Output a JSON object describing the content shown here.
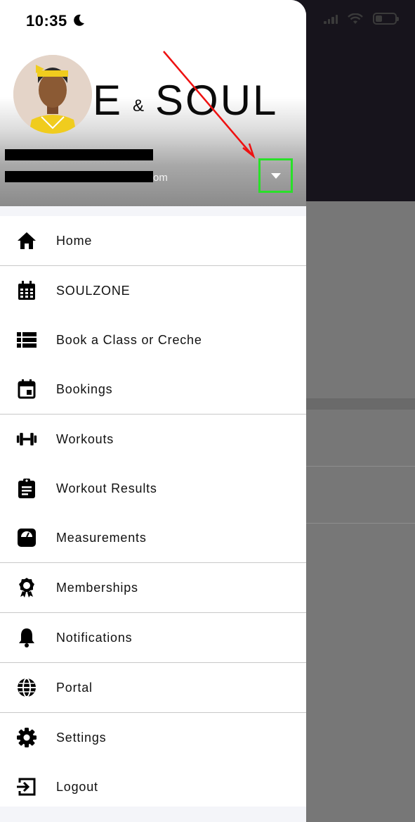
{
  "status_bar": {
    "time": "10:35"
  },
  "brand": {
    "text_left": "E",
    "amp": "&",
    "text_right": "SOUL"
  },
  "user": {
    "email_visible_suffix": "om"
  },
  "menu": {
    "items": [
      {
        "label": "Home",
        "icon": "home-icon"
      },
      {
        "label": "SOULZONE",
        "icon": "calendar-grid-icon"
      },
      {
        "label": "Book a Class or Creche",
        "icon": "list-icon"
      },
      {
        "label": "Bookings",
        "icon": "calendar-event-icon"
      },
      {
        "label": "Workouts",
        "icon": "dumbbell-icon"
      },
      {
        "label": "Workout Results",
        "icon": "clipboard-icon"
      },
      {
        "label": "Measurements",
        "icon": "scale-icon"
      },
      {
        "label": "Memberships",
        "icon": "award-icon"
      },
      {
        "label": "Notifications",
        "icon": "bell-icon"
      },
      {
        "label": "Portal",
        "icon": "globe-icon"
      },
      {
        "label": "Settings",
        "icon": "gear-icon"
      },
      {
        "label": "Logout",
        "icon": "logout-icon"
      }
    ]
  },
  "colors": {
    "highlight_box": "#29e029",
    "annotation_arrow": "#ee1111",
    "overlay": "#777777",
    "dark_app_header": "#17141c"
  }
}
